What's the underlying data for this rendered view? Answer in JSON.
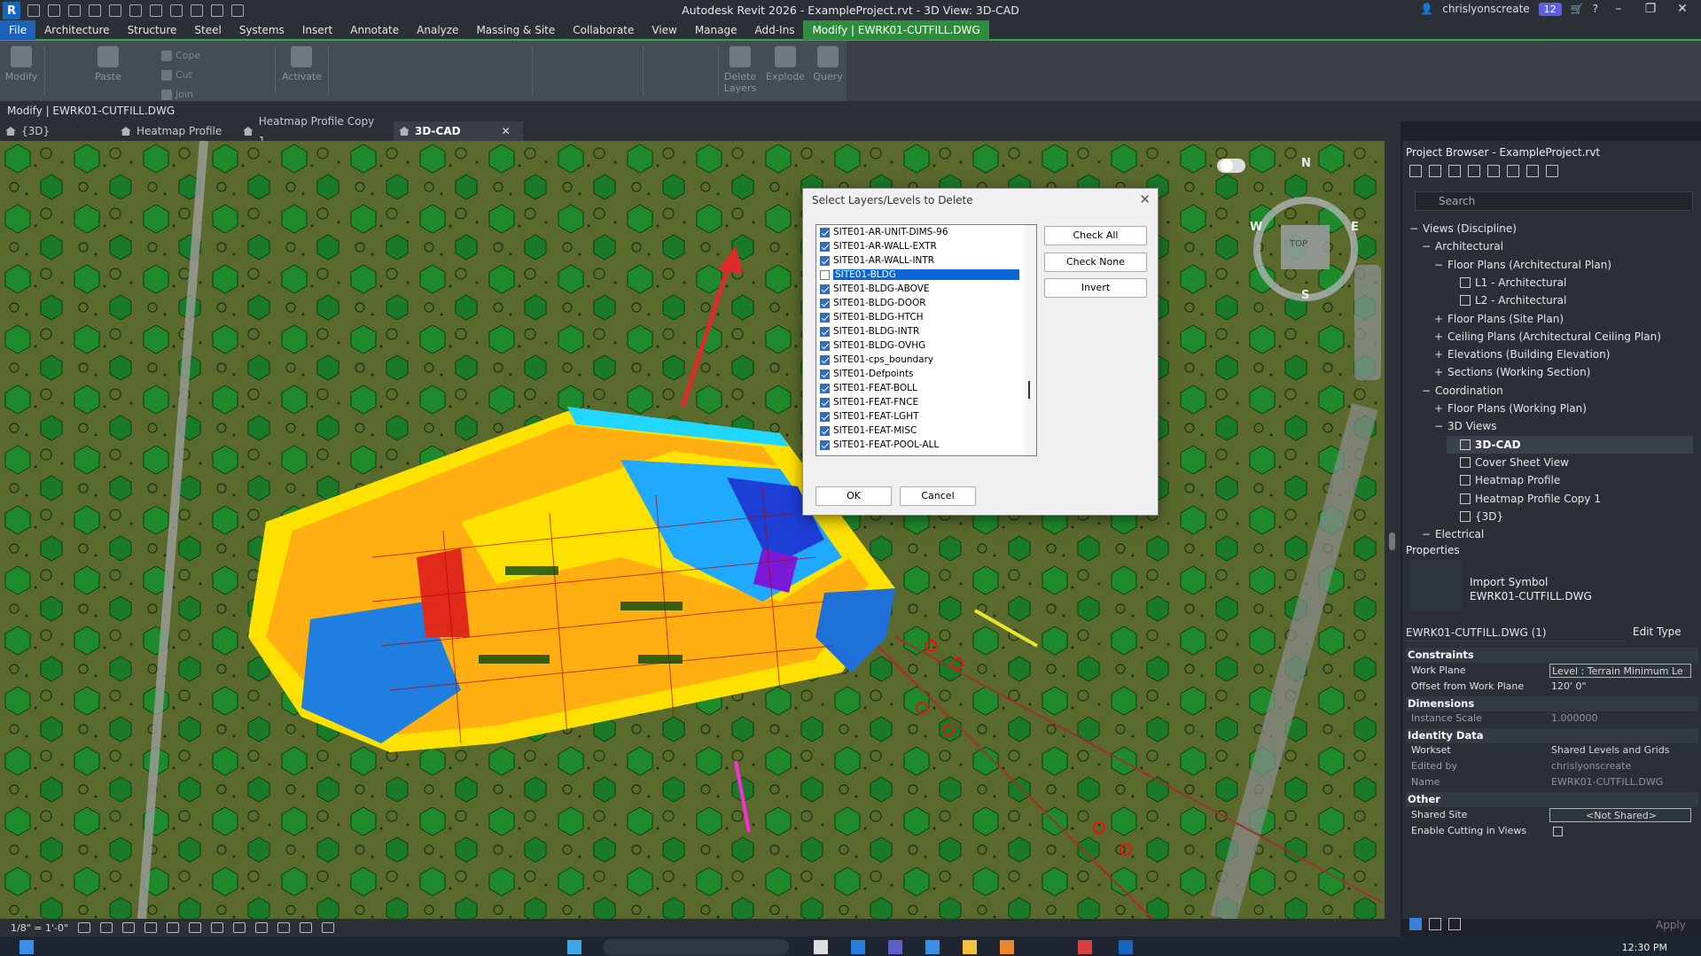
{
  "window": {
    "title": "Autodesk Revit 2026 - ExampleProject.rvt - 3D View: 3D-CAD",
    "user": "chrislyonscreate",
    "updates_count": "12"
  },
  "ribbon_tabs": [
    "File",
    "Architecture",
    "Structure",
    "Steel",
    "Systems",
    "Insert",
    "Annotate",
    "Analyze",
    "Massing & Site",
    "Collaborate",
    "View",
    "Manage",
    "Add-Ins",
    "Modify | EWRK01-CUTFILL.DWG"
  ],
  "ribbon": {
    "modify": "Modify",
    "paste": "Paste",
    "cope": "Cope",
    "cut": "Cut",
    "join": "Join",
    "activate": "Activate",
    "delete_layers": "Delete Layers",
    "explode": "Explode",
    "query": "Query"
  },
  "options_bar": "Modify | EWRK01-CUTFILL.DWG",
  "view_tabs": [
    "{3D}",
    "Heatmap Profile",
    "Heatmap Profile Copy 1",
    "3D-CAD"
  ],
  "view_close": "✕",
  "view_scale": "1/8\" = 1'-0\"",
  "dialog": {
    "title": "Select Layers/Levels to Delete",
    "layers": [
      {
        "name": "SITE01-AR-UNIT-DIMS-96",
        "checked": true
      },
      {
        "name": "SITE01-AR-WALL-EXTR",
        "checked": true
      },
      {
        "name": "SITE01-AR-WALL-INTR",
        "checked": true
      },
      {
        "name": "SITE01-BLDG",
        "checked": false,
        "selected": true
      },
      {
        "name": "SITE01-BLDG-ABOVE",
        "checked": true
      },
      {
        "name": "SITE01-BLDG-DOOR",
        "checked": true
      },
      {
        "name": "SITE01-BLDG-HTCH",
        "checked": true
      },
      {
        "name": "SITE01-BLDG-INTR",
        "checked": true
      },
      {
        "name": "SITE01-BLDG-OVHG",
        "checked": true
      },
      {
        "name": "SITE01-cps_boundary",
        "checked": true
      },
      {
        "name": "SITE01-Defpoints",
        "checked": true
      },
      {
        "name": "SITE01-FEAT-BOLL",
        "checked": true
      },
      {
        "name": "SITE01-FEAT-FNCE",
        "checked": true
      },
      {
        "name": "SITE01-FEAT-LGHT",
        "checked": true
      },
      {
        "name": "SITE01-FEAT-MISC",
        "checked": true
      },
      {
        "name": "SITE01-FEAT-POOL-ALL",
        "checked": true
      }
    ],
    "check_all": "Check All",
    "check_none": "Check None",
    "invert": "Invert",
    "ok": "OK",
    "cancel": "Cancel"
  },
  "project_browser": {
    "title": "Project Browser - ExampleProject.rvt",
    "search_placeholder": "Search",
    "tree": [
      {
        "label": "Views (Discipline)",
        "toggle": "−"
      },
      {
        "label": "Architectural",
        "toggle": "−"
      },
      {
        "label": "Floor Plans (Architectural Plan)",
        "toggle": "−"
      },
      {
        "label": "L1 - Architectural",
        "toggle": ""
      },
      {
        "label": "L2 - Architectural",
        "toggle": ""
      },
      {
        "label": "Floor Plans (Site Plan)",
        "toggle": "+"
      },
      {
        "label": "Ceiling Plans (Architectural Ceiling Plan)",
        "toggle": "+"
      },
      {
        "label": "Elevations (Building Elevation)",
        "toggle": "+"
      },
      {
        "label": "Sections (Working Section)",
        "toggle": "+"
      },
      {
        "label": "Coordination",
        "toggle": "−"
      },
      {
        "label": "Floor Plans (Working Plan)",
        "toggle": "+"
      },
      {
        "label": "3D Views",
        "toggle": "−"
      },
      {
        "label": "3D-CAD",
        "toggle": ""
      },
      {
        "label": "Cover Sheet View",
        "toggle": ""
      },
      {
        "label": "Heatmap Profile",
        "toggle": ""
      },
      {
        "label": "Heatmap Profile Copy 1",
        "toggle": ""
      },
      {
        "label": "{3D}",
        "toggle": ""
      },
      {
        "label": "Electrical",
        "toggle": "−"
      }
    ]
  },
  "properties": {
    "title": "Properties",
    "type_label": "Import Symbol",
    "type_name": "EWRK01-CUTFILL.DWG",
    "instance_selector": "EWRK01-CUTFILL.DWG (1)",
    "edit_type": "Edit Type",
    "sections": {
      "constraints": "Constraints",
      "dimensions": "Dimensions",
      "identity": "Identity Data",
      "other": "Other"
    },
    "rows": {
      "work_plane_k": "Work Plane",
      "work_plane_v": "Level : Terrain Minimum Le",
      "offset_k": "Offset from Work Plane",
      "offset_v": "120'  0\"",
      "scale_k": "Instance Scale",
      "scale_v": "1.000000",
      "workset_k": "Workset",
      "workset_v": "Shared Levels and Grids",
      "edited_k": "Edited by",
      "edited_v": "chrislyonscreate",
      "name_k": "Name",
      "name_v": "EWRK01-CUTFILL.DWG",
      "shared_k": "Shared Site",
      "shared_v": "<Not Shared>",
      "cutting_k": "Enable Cutting in Views"
    },
    "apply": "Apply"
  },
  "viewcube": {
    "n": "N",
    "s": "S",
    "e": "E",
    "w": "W",
    "top": "TOP"
  },
  "clock": "12:30 PM",
  "colors": {
    "accent": "#1c62b9",
    "context_tab": "#2f8c3d",
    "arrow": "#e02a2a"
  }
}
